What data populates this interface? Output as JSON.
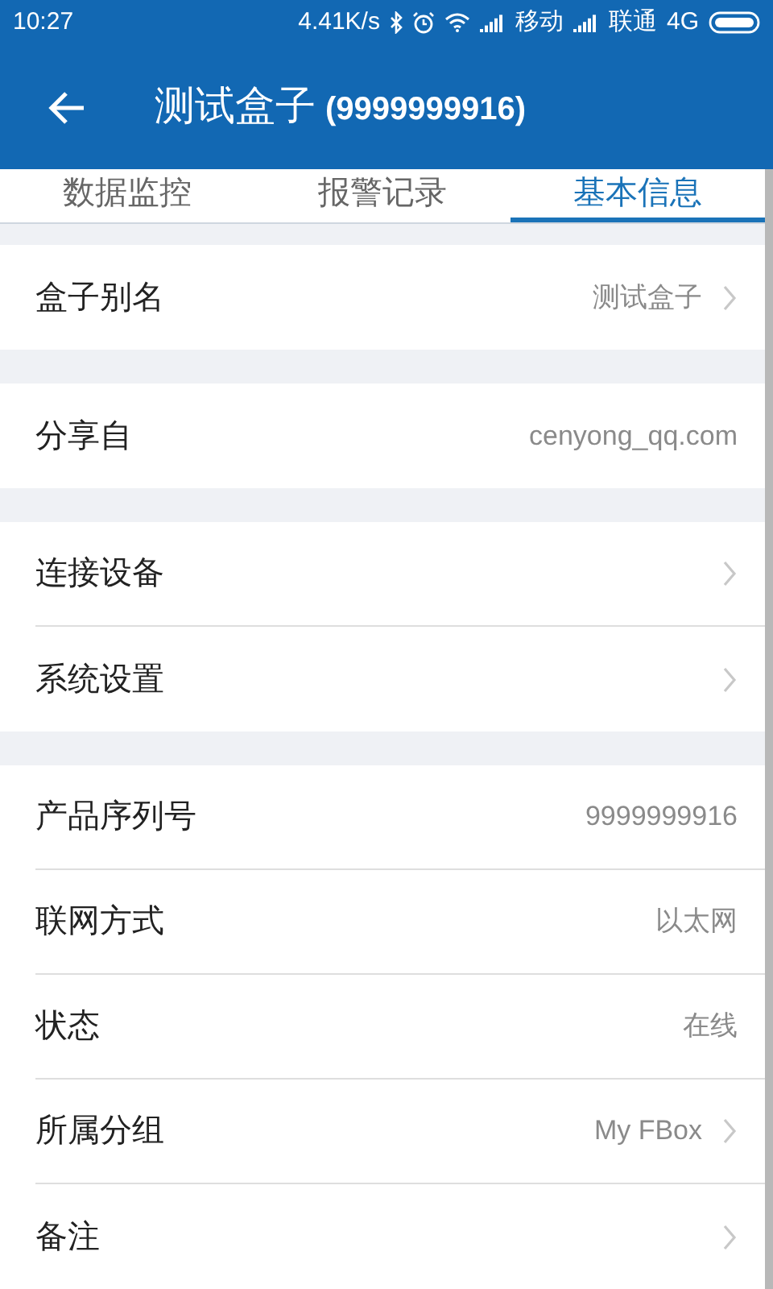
{
  "status_bar": {
    "time": "10:27",
    "speed": "4.41K/s",
    "carrier_1": "移动",
    "carrier_2": "联通",
    "network": "4G"
  },
  "header": {
    "title": "测试盒子",
    "id": "(9999999916)"
  },
  "tabs": [
    {
      "label": "数据监控",
      "selected": false
    },
    {
      "label": "报警记录",
      "selected": false
    },
    {
      "label": "基本信息",
      "selected": true
    }
  ],
  "groups": [
    [
      {
        "label": "盒子别名",
        "value": "测试盒子",
        "chevron": true
      }
    ],
    [
      {
        "label": "分享自",
        "value": "cenyong_qq.com",
        "chevron": false
      }
    ],
    [
      {
        "label": "连接设备",
        "chevron": true
      },
      {
        "label": "系统设置",
        "chevron": true
      }
    ],
    [
      {
        "label": "产品序列号",
        "value": "9999999916",
        "chevron": false
      },
      {
        "label": "联网方式",
        "value": "以太网",
        "chevron": false
      },
      {
        "label": "状态",
        "value": "在线",
        "chevron": false
      },
      {
        "label": "所属分组",
        "value": "My FBox",
        "chevron": true
      },
      {
        "label": "备注",
        "chevron": true
      }
    ]
  ]
}
